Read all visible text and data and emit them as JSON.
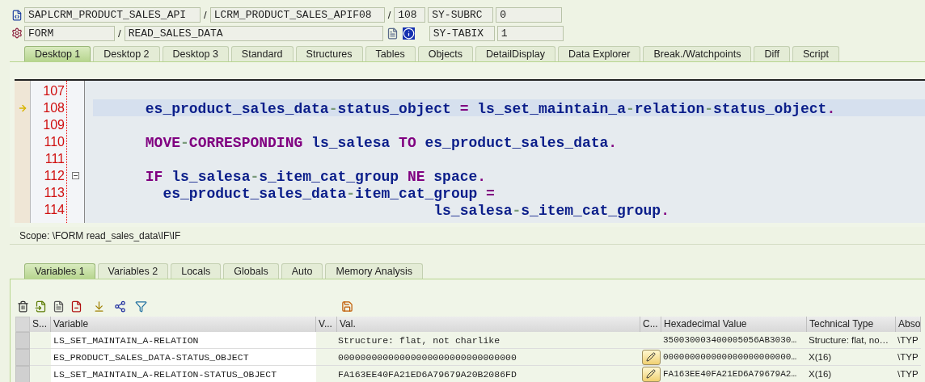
{
  "header": {
    "row1": {
      "program": "SAPLCRM_PRODUCT_SALES_API",
      "sep1": "/",
      "sep2": "/",
      "include": "LCRM_PRODUCT_SALES_APIF08",
      "line": "108",
      "sysfield": "SY-SUBRC",
      "sysvalue": "0"
    },
    "row2": {
      "type": "FORM",
      "sep": "/",
      "name": "READ_SALES_DATA",
      "sysfield": "SY-TABIX",
      "sysvalue": "1"
    }
  },
  "tabs": [
    {
      "label": "Desktop 1",
      "selected": true
    },
    {
      "label": "Desktop 2",
      "selected": false
    },
    {
      "label": "Desktop 3",
      "selected": false
    },
    {
      "label": "Standard",
      "selected": false
    },
    {
      "label": "Structures",
      "selected": false
    },
    {
      "label": "Tables",
      "selected": false
    },
    {
      "label": "Objects",
      "selected": false
    },
    {
      "label": "DetailDisplay",
      "selected": false
    },
    {
      "label": "Data Explorer",
      "selected": false
    },
    {
      "label": "Break./Watchpoints",
      "selected": false
    },
    {
      "label": "Diff",
      "selected": false
    },
    {
      "label": "Script",
      "selected": false
    }
  ],
  "code": [
    {
      "number": "107",
      "current": false,
      "fold": false
    },
    {
      "number": "108",
      "current": true,
      "fold": false,
      "tokens": [
        {
          "text": "      es_product_sales_data",
          "kind": "name"
        },
        {
          "text": "-",
          "kind": "dash"
        },
        {
          "text": "status_object ",
          "kind": "name"
        },
        {
          "text": "=",
          "kind": "punct"
        },
        {
          "text": " ls_set_maintain_a",
          "kind": "name"
        },
        {
          "text": "-",
          "kind": "dash"
        },
        {
          "text": "relation",
          "kind": "name"
        },
        {
          "text": "-",
          "kind": "dash"
        },
        {
          "text": "status_object",
          "kind": "name"
        },
        {
          "text": ".",
          "kind": "punct"
        }
      ]
    },
    {
      "number": "109",
      "current": false,
      "fold": false
    },
    {
      "number": "110",
      "current": false,
      "fold": false,
      "tokens": [
        {
          "text": "      MOVE",
          "kind": "keyword"
        },
        {
          "text": "-",
          "kind": "dash"
        },
        {
          "text": "CORRESPONDING",
          "kind": "keyword"
        },
        {
          "text": " ls_salesa ",
          "kind": "name"
        },
        {
          "text": "TO",
          "kind": "keyword"
        },
        {
          "text": " es_product_sales_data",
          "kind": "name"
        },
        {
          "text": ".",
          "kind": "punct"
        }
      ]
    },
    {
      "number": "111",
      "current": false,
      "fold": false
    },
    {
      "number": "112",
      "current": false,
      "fold": true,
      "tokens": [
        {
          "text": "      IF",
          "kind": "keyword"
        },
        {
          "text": " ls_salesa",
          "kind": "name"
        },
        {
          "text": "-",
          "kind": "dash"
        },
        {
          "text": "s_item_cat_group ",
          "kind": "name"
        },
        {
          "text": "NE",
          "kind": "keyword"
        },
        {
          "text": " space",
          "kind": "name"
        },
        {
          "text": ".",
          "kind": "punct"
        }
      ]
    },
    {
      "number": "113",
      "current": false,
      "fold": false,
      "tokens": [
        {
          "text": "        es_product_sales_data",
          "kind": "name"
        },
        {
          "text": "-",
          "kind": "dash"
        },
        {
          "text": "item_cat_group ",
          "kind": "name"
        },
        {
          "text": "=",
          "kind": "punct"
        }
      ]
    },
    {
      "number": "114",
      "current": false,
      "fold": false,
      "tokens": [
        {
          "text": "                                       ls_salesa",
          "kind": "name"
        },
        {
          "text": "-",
          "kind": "dash"
        },
        {
          "text": "s_item_cat_group",
          "kind": "name"
        },
        {
          "text": ".",
          "kind": "punct"
        }
      ]
    }
  ],
  "scope": "Scope: \\FORM read_sales_data\\IF\\IF",
  "var_tabs": [
    {
      "label": "Variables 1",
      "selected": true
    },
    {
      "label": "Variables 2",
      "selected": false
    },
    {
      "label": "Locals",
      "selected": false
    },
    {
      "label": "Globals",
      "selected": false
    },
    {
      "label": "Auto",
      "selected": false
    },
    {
      "label": "Memory Analysis",
      "selected": false
    }
  ],
  "table": {
    "columns": [
      "S...",
      "Variable",
      "V...",
      "Val.",
      "C...",
      "Hexadecimal Value",
      "Technical Type",
      "Abso"
    ],
    "rows": [
      {
        "variable": "LS_SET_MAINTAIN_A-RELATION",
        "value": "Structure: flat, not charlike",
        "editable": false,
        "hex": "350030003400005056AB3030…",
        "type": "Structure: flat, no…",
        "absolute": "\\TYP"
      },
      {
        "variable": "ES_PRODUCT_SALES_DATA-STATUS_OBJECT",
        "value": "00000000000000000000000000000000",
        "editable": true,
        "hex": "000000000000000000000000…",
        "type": "X(16)",
        "absolute": "\\TYP"
      },
      {
        "variable": "LS_SET_MAINTAIN_A-RELATION-STATUS_OBJECT",
        "value": "FA163EE40FA21ED6A79679A20B2086FD",
        "editable": true,
        "hex": "FA163EE40FA21ED6A79679A2…",
        "type": "X(16)",
        "absolute": "\\TYP"
      }
    ]
  }
}
